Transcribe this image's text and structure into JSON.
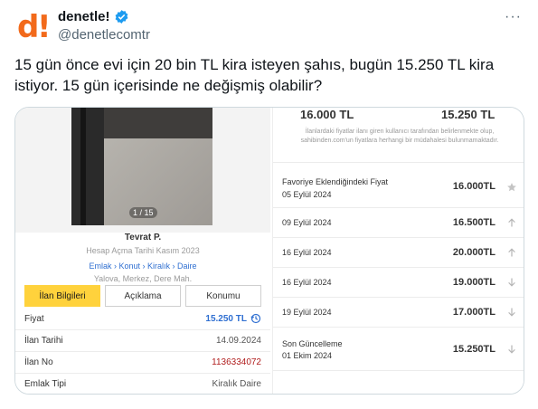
{
  "account": {
    "display_name": "denetle!",
    "handle": "@denetlecomtr",
    "logo_letter": "d",
    "logo_mark": "!",
    "verified_icon": "verified-badge-icon",
    "brand_color": "#f26a1b"
  },
  "more_label": "···",
  "tweet_text": "15 gün önce evi için 20 bin TL kira isteyen şahıs, bugün 15.250 TL kira istiyor. 15 gün içerisinde ne değişmiş olabilir?",
  "listing": {
    "photo_counter": "1 / 15",
    "owner": "Tevrat P.",
    "account_since": "Hesap Açma Tarihi Kasım 2023",
    "breadcrumbs": "Emlak › Konut › Kiralık › Daire",
    "location": "Yalova, Merkez, Dere Mah.",
    "tabs": [
      {
        "label": "İlan Bilgileri"
      },
      {
        "label": "Açıklama"
      },
      {
        "label": "Konumu"
      }
    ],
    "details": [
      {
        "key": "Fiyat",
        "value": "15.250 TL"
      },
      {
        "key": "İlan Tarihi",
        "value": "14.09.2024"
      },
      {
        "key": "İlan No",
        "value": "1136334072"
      },
      {
        "key": "Emlak Tipi",
        "value": "Kiralık Daire"
      }
    ]
  },
  "price_history": {
    "old_price": "16.000 TL",
    "new_price": "15.250 TL",
    "disclaimer": "İlanlardaki fiyatlar ilanı giren kullanıcı tarafından belirlenmekte olup, sahibinden.com'un fiyatlara herhangi bir müdahalesi bulunmamaktadır.",
    "rows": [
      {
        "label": "Favoriye Eklendiğindeki Fiyat",
        "date": "05 Eylül 2024",
        "amount": "16.000TL",
        "icon": "star-icon"
      },
      {
        "label": "09 Eylül 2024",
        "amount": "16.500TL",
        "icon": "arrow-up-icon"
      },
      {
        "label": "16 Eylül 2024",
        "amount": "20.000TL",
        "icon": "arrow-up-icon"
      },
      {
        "label": "16 Eylül 2024",
        "amount": "19.000TL",
        "icon": "arrow-down-icon"
      },
      {
        "label": "19 Eylül 2024",
        "amount": "17.000TL",
        "icon": "arrow-down-icon"
      },
      {
        "label": "Son Güncelleme",
        "date": "01 Ekim 2024",
        "amount": "15.250TL",
        "icon": "arrow-down-icon"
      }
    ]
  }
}
